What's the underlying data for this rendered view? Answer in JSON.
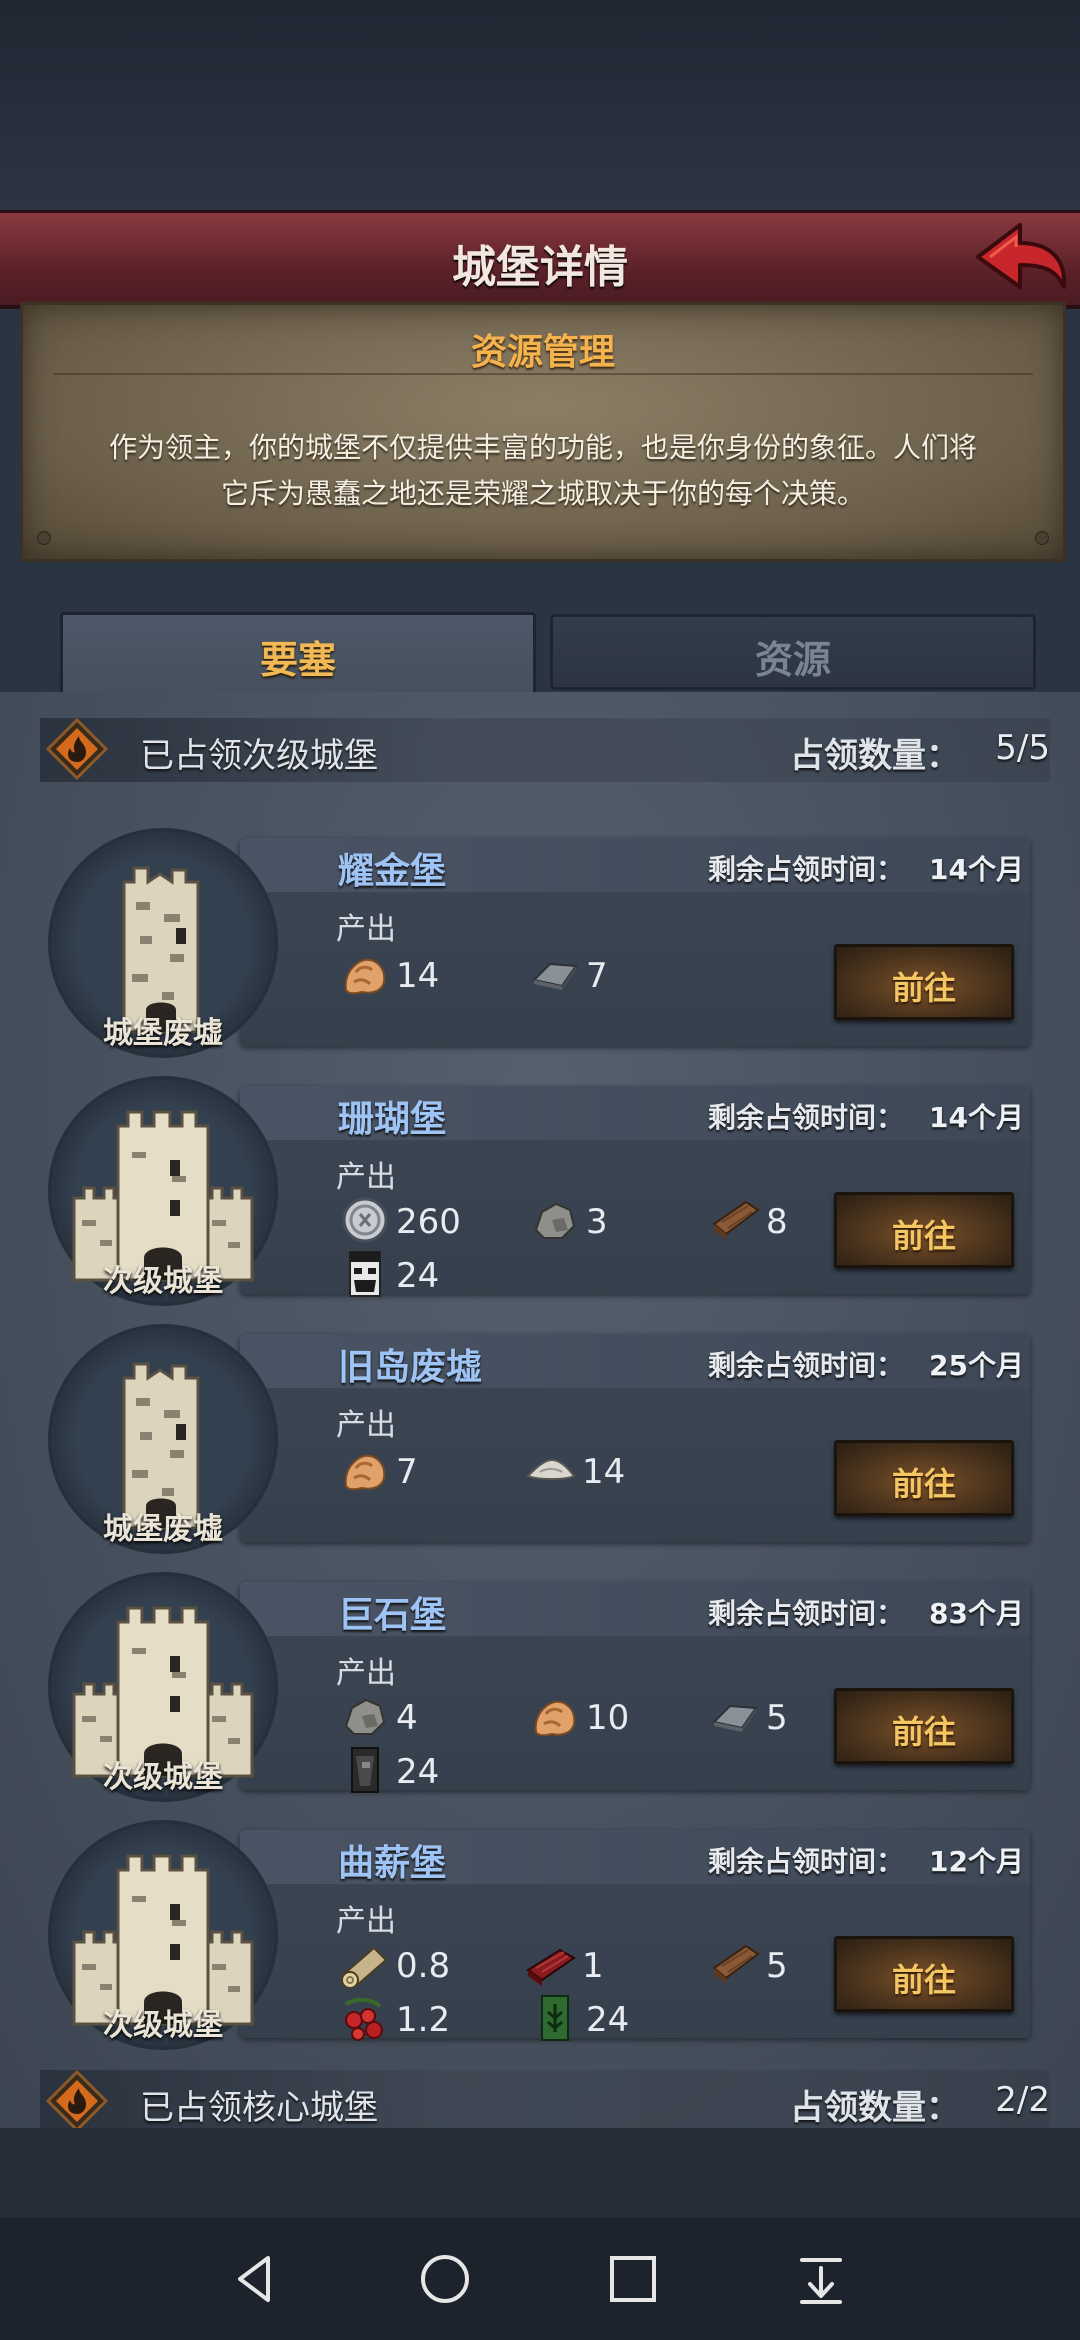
{
  "header": {
    "title": "城堡详情"
  },
  "intro": {
    "heading": "资源管理",
    "line1": "作为领主，你的城堡不仅提供丰富的功能，也是你身份的象征。人们将",
    "line2": "它斥为愚蠢之地还是荣耀之城取决于你的每个决策。"
  },
  "tabs": [
    {
      "label": "要塞",
      "active": true
    },
    {
      "label": "资源",
      "active": false
    }
  ],
  "sections": [
    {
      "title": "已占领次级城堡",
      "count_label": "占领数量：",
      "count": "5/5"
    },
    {
      "title": "已占领核心城堡",
      "count_label": "占领数量：",
      "count": "2/2"
    }
  ],
  "common": {
    "time_label": "剩余占领时间：",
    "output_label": "产出",
    "goto_label": "前往"
  },
  "castles": [
    {
      "name": "耀金堡",
      "type": "城堡废墟",
      "time": "14个月",
      "outputs": [
        {
          "icon": "ore-icon",
          "value": "14"
        },
        {
          "icon": "iron-ingot-icon",
          "value": "7"
        }
      ]
    },
    {
      "name": "珊瑚堡",
      "type": "次级城堡",
      "time": "14个月",
      "outputs": [
        {
          "icon": "silver-coin-icon",
          "value": "260"
        },
        {
          "icon": "stone-icon",
          "value": "3"
        },
        {
          "icon": "wood-plank-icon",
          "value": "8"
        },
        {
          "icon": "soldier-banner-icon",
          "value": "24"
        }
      ]
    },
    {
      "name": "旧岛废墟",
      "type": "城堡废墟",
      "time": "25个月",
      "outputs": [
        {
          "icon": "ore-icon",
          "value": "7"
        },
        {
          "icon": "salt-icon",
          "value": "14"
        }
      ]
    },
    {
      "name": "巨石堡",
      "type": "次级城堡",
      "time": "83个月",
      "outputs": [
        {
          "icon": "stone-icon",
          "value": "4"
        },
        {
          "icon": "ore-icon",
          "value": "10"
        },
        {
          "icon": "iron-ingot-icon",
          "value": "5"
        },
        {
          "icon": "dark-banner-icon",
          "value": "24"
        }
      ]
    },
    {
      "name": "曲薪堡",
      "type": "次级城堡",
      "time": "12个月",
      "outputs": [
        {
          "icon": "log-icon",
          "value": "0.8"
        },
        {
          "icon": "red-wood-icon",
          "value": "1"
        },
        {
          "icon": "wood-plank-icon",
          "value": "5"
        },
        {
          "icon": "berries-icon",
          "value": "1.2"
        },
        {
          "icon": "green-banner-icon",
          "value": "24"
        }
      ]
    }
  ],
  "colors": {
    "accent": "#f2b854",
    "castle_name": "#9ec3f5",
    "title_bar": "#6b2a31"
  }
}
